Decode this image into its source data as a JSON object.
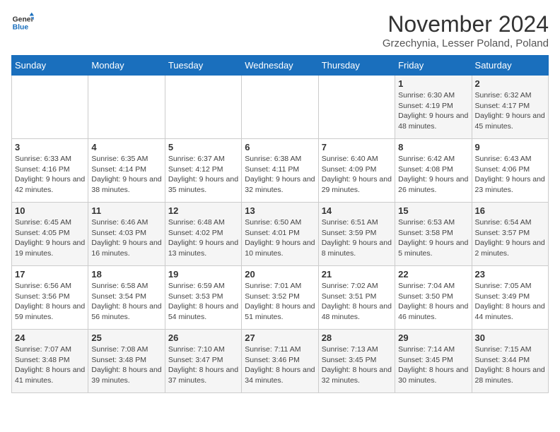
{
  "logo": {
    "line1": "General",
    "line2": "Blue"
  },
  "title": "November 2024",
  "subtitle": "Grzechynia, Lesser Poland, Poland",
  "weekdays": [
    "Sunday",
    "Monday",
    "Tuesday",
    "Wednesday",
    "Thursday",
    "Friday",
    "Saturday"
  ],
  "weeks": [
    [
      {
        "day": "",
        "info": ""
      },
      {
        "day": "",
        "info": ""
      },
      {
        "day": "",
        "info": ""
      },
      {
        "day": "",
        "info": ""
      },
      {
        "day": "",
        "info": ""
      },
      {
        "day": "1",
        "info": "Sunrise: 6:30 AM\nSunset: 4:19 PM\nDaylight: 9 hours and 48 minutes."
      },
      {
        "day": "2",
        "info": "Sunrise: 6:32 AM\nSunset: 4:17 PM\nDaylight: 9 hours and 45 minutes."
      }
    ],
    [
      {
        "day": "3",
        "info": "Sunrise: 6:33 AM\nSunset: 4:16 PM\nDaylight: 9 hours and 42 minutes."
      },
      {
        "day": "4",
        "info": "Sunrise: 6:35 AM\nSunset: 4:14 PM\nDaylight: 9 hours and 38 minutes."
      },
      {
        "day": "5",
        "info": "Sunrise: 6:37 AM\nSunset: 4:12 PM\nDaylight: 9 hours and 35 minutes."
      },
      {
        "day": "6",
        "info": "Sunrise: 6:38 AM\nSunset: 4:11 PM\nDaylight: 9 hours and 32 minutes."
      },
      {
        "day": "7",
        "info": "Sunrise: 6:40 AM\nSunset: 4:09 PM\nDaylight: 9 hours and 29 minutes."
      },
      {
        "day": "8",
        "info": "Sunrise: 6:42 AM\nSunset: 4:08 PM\nDaylight: 9 hours and 26 minutes."
      },
      {
        "day": "9",
        "info": "Sunrise: 6:43 AM\nSunset: 4:06 PM\nDaylight: 9 hours and 23 minutes."
      }
    ],
    [
      {
        "day": "10",
        "info": "Sunrise: 6:45 AM\nSunset: 4:05 PM\nDaylight: 9 hours and 19 minutes."
      },
      {
        "day": "11",
        "info": "Sunrise: 6:46 AM\nSunset: 4:03 PM\nDaylight: 9 hours and 16 minutes."
      },
      {
        "day": "12",
        "info": "Sunrise: 6:48 AM\nSunset: 4:02 PM\nDaylight: 9 hours and 13 minutes."
      },
      {
        "day": "13",
        "info": "Sunrise: 6:50 AM\nSunset: 4:01 PM\nDaylight: 9 hours and 10 minutes."
      },
      {
        "day": "14",
        "info": "Sunrise: 6:51 AM\nSunset: 3:59 PM\nDaylight: 9 hours and 8 minutes."
      },
      {
        "day": "15",
        "info": "Sunrise: 6:53 AM\nSunset: 3:58 PM\nDaylight: 9 hours and 5 minutes."
      },
      {
        "day": "16",
        "info": "Sunrise: 6:54 AM\nSunset: 3:57 PM\nDaylight: 9 hours and 2 minutes."
      }
    ],
    [
      {
        "day": "17",
        "info": "Sunrise: 6:56 AM\nSunset: 3:56 PM\nDaylight: 8 hours and 59 minutes."
      },
      {
        "day": "18",
        "info": "Sunrise: 6:58 AM\nSunset: 3:54 PM\nDaylight: 8 hours and 56 minutes."
      },
      {
        "day": "19",
        "info": "Sunrise: 6:59 AM\nSunset: 3:53 PM\nDaylight: 8 hours and 54 minutes."
      },
      {
        "day": "20",
        "info": "Sunrise: 7:01 AM\nSunset: 3:52 PM\nDaylight: 8 hours and 51 minutes."
      },
      {
        "day": "21",
        "info": "Sunrise: 7:02 AM\nSunset: 3:51 PM\nDaylight: 8 hours and 48 minutes."
      },
      {
        "day": "22",
        "info": "Sunrise: 7:04 AM\nSunset: 3:50 PM\nDaylight: 8 hours and 46 minutes."
      },
      {
        "day": "23",
        "info": "Sunrise: 7:05 AM\nSunset: 3:49 PM\nDaylight: 8 hours and 44 minutes."
      }
    ],
    [
      {
        "day": "24",
        "info": "Sunrise: 7:07 AM\nSunset: 3:48 PM\nDaylight: 8 hours and 41 minutes."
      },
      {
        "day": "25",
        "info": "Sunrise: 7:08 AM\nSunset: 3:48 PM\nDaylight: 8 hours and 39 minutes."
      },
      {
        "day": "26",
        "info": "Sunrise: 7:10 AM\nSunset: 3:47 PM\nDaylight: 8 hours and 37 minutes."
      },
      {
        "day": "27",
        "info": "Sunrise: 7:11 AM\nSunset: 3:46 PM\nDaylight: 8 hours and 34 minutes."
      },
      {
        "day": "28",
        "info": "Sunrise: 7:13 AM\nSunset: 3:45 PM\nDaylight: 8 hours and 32 minutes."
      },
      {
        "day": "29",
        "info": "Sunrise: 7:14 AM\nSunset: 3:45 PM\nDaylight: 8 hours and 30 minutes."
      },
      {
        "day": "30",
        "info": "Sunrise: 7:15 AM\nSunset: 3:44 PM\nDaylight: 8 hours and 28 minutes."
      }
    ]
  ]
}
